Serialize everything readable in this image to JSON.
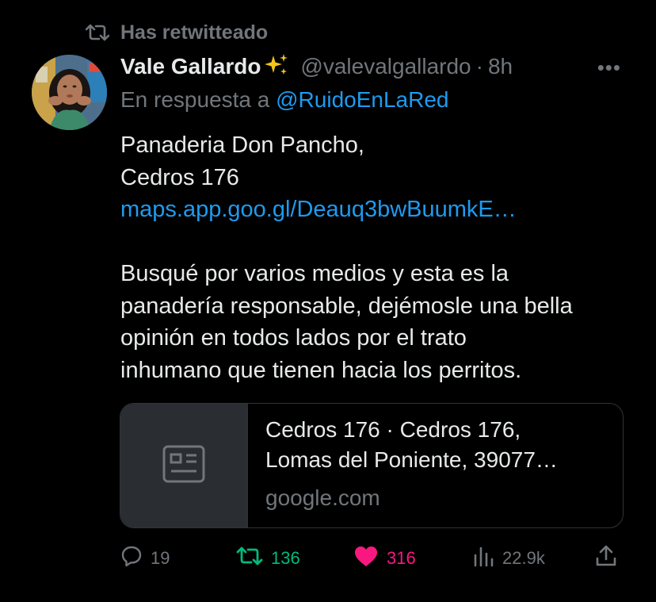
{
  "retweet": {
    "label": "Has retwitteado",
    "icon": "retweet-icon"
  },
  "author": {
    "name": "Vale Gallardo",
    "emoji": "sparkles-icon",
    "handle": "@valevalgallardo",
    "separator": "·",
    "time": "8h",
    "more_label": "•••"
  },
  "reply_to": {
    "prefix": "En respuesta a ",
    "mention": "@RuidoEnLaRed"
  },
  "body": {
    "line1": "Panaderia Don Pancho,",
    "line2": "Cedros 176",
    "link": "maps.app.goo.gl/Deauq3bwBuumkE…",
    "p2_line1": "Busqué por varios medios y esta es la",
    "p2_line2": "panadería responsable, dejémosle una bella",
    "p2_line3": "opinión en todos lados por el trato",
    "p2_line4": "inhumano que tienen hacia los perritos."
  },
  "card": {
    "title_line1": "Cedros 176 · Cedros 176,",
    "title_line2": "Lomas del Poniente, 39077…",
    "domain": "google.com",
    "icon": "article-icon"
  },
  "actions": {
    "replies": "19",
    "retweets": "136",
    "likes": "316",
    "views": "22.9k"
  },
  "colors": {
    "background": "#000000",
    "text": "#e7e9ea",
    "muted": "#71767b",
    "link": "#1d9bf0",
    "retweet_active": "#00ba7c",
    "like_active": "#f91880"
  }
}
